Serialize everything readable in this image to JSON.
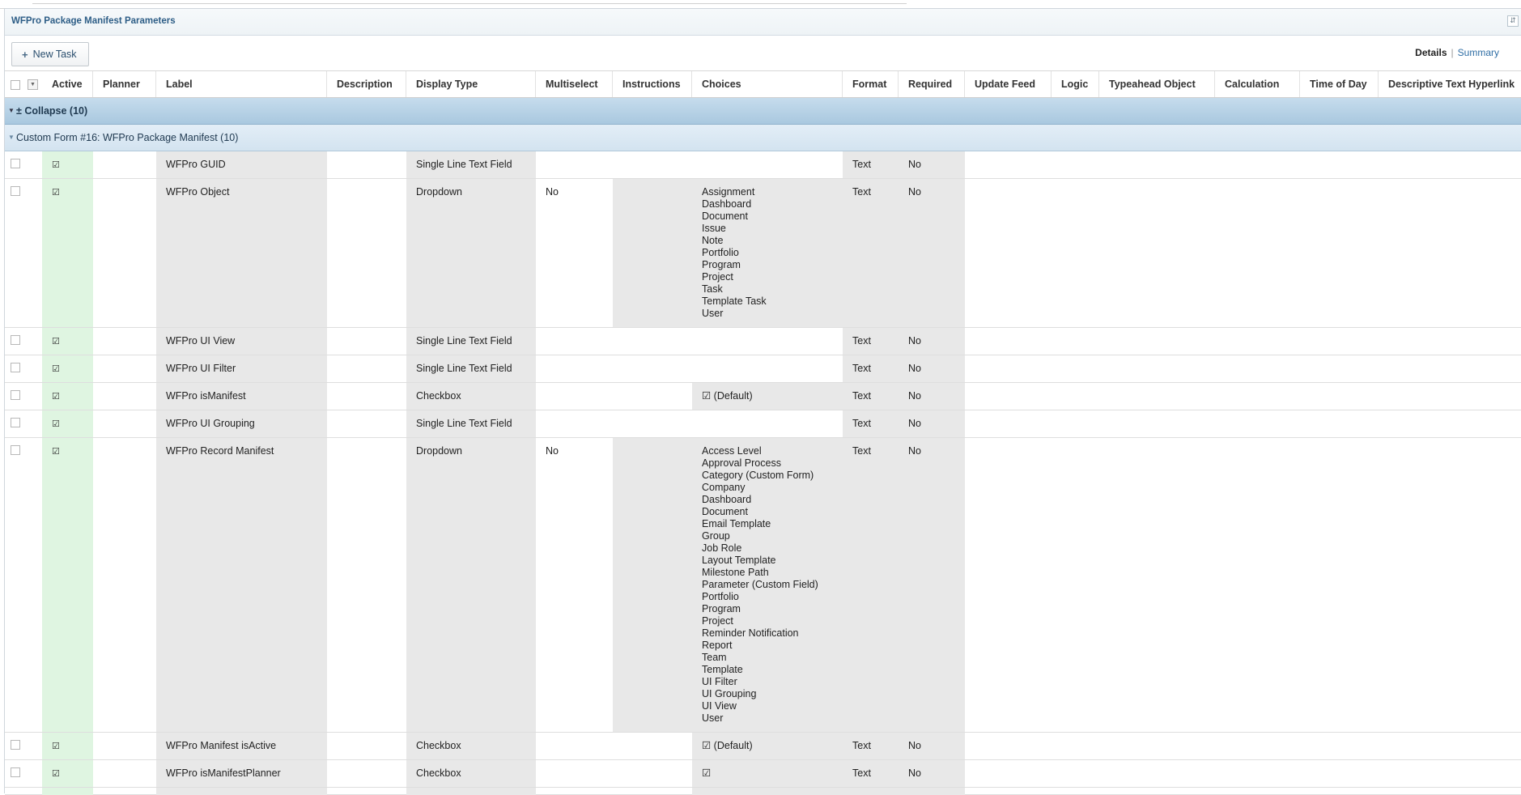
{
  "window": {
    "title": "WFPro Package Manifest Parameters"
  },
  "toolbar": {
    "new_task_label": "New Task",
    "details_label": "Details",
    "summary_label": "Summary"
  },
  "columns": [
    "Active",
    "Planner",
    "Label",
    "Description",
    "Display Type",
    "Multiselect",
    "Instructions",
    "Choices",
    "Format",
    "Required",
    "Update Feed",
    "Logic",
    "Typeahead Object",
    "Calculation",
    "Time of Day",
    "Descriptive Text Hyperlink"
  ],
  "groups": {
    "collapse_label": "± Collapse (10)",
    "form_label": "Custom Form #16: WFPro Package Manifest (10)"
  },
  "rows": [
    {
      "active": "☑",
      "label": "WFPro GUID",
      "display_type": "Single Line Text Field",
      "multiselect": "",
      "choices": [],
      "format": "Text",
      "required": "No"
    },
    {
      "active": "☑",
      "label": "WFPro Object",
      "display_type": "Dropdown",
      "multiselect": "No",
      "choices": [
        "Assignment",
        "Dashboard",
        "Document",
        "Issue",
        "Note",
        "Portfolio",
        "Program",
        "Project",
        "Task",
        "Template Task",
        "User"
      ],
      "format": "Text",
      "required": "No"
    },
    {
      "active": "☑",
      "label": "WFPro UI View",
      "display_type": "Single Line Text Field",
      "multiselect": "",
      "choices": [],
      "format": "Text",
      "required": "No"
    },
    {
      "active": "☑",
      "label": "WFPro UI Filter",
      "display_type": "Single Line Text Field",
      "multiselect": "",
      "choices": [],
      "format": "Text",
      "required": "No"
    },
    {
      "active": "☑",
      "label": "WFPro isManifest",
      "display_type": "Checkbox",
      "multiselect": "",
      "choices": [
        "☑ (Default)"
      ],
      "format": "Text",
      "required": "No"
    },
    {
      "active": "☑",
      "label": "WFPro UI Grouping",
      "display_type": "Single Line Text Field",
      "multiselect": "",
      "choices": [],
      "format": "Text",
      "required": "No"
    },
    {
      "active": "☑",
      "label": "WFPro Record Manifest",
      "display_type": "Dropdown",
      "multiselect": "No",
      "choices": [
        "Access Level",
        "Approval Process",
        "Category (Custom Form)",
        "Company",
        "Dashboard",
        "Document",
        "Email Template",
        "Group",
        "Job Role",
        "Layout Template",
        "Milestone Path",
        "Parameter (Custom Field)",
        "Portfolio",
        "Program",
        "Project",
        "Reminder Notification",
        "Report",
        "Team",
        "Template",
        "UI Filter",
        "UI Grouping",
        "UI View",
        "User"
      ],
      "format": "Text",
      "required": "No"
    },
    {
      "active": "☑",
      "label": "WFPro Manifest isActive",
      "display_type": "Checkbox",
      "multiselect": "",
      "choices": [
        "☑ (Default)"
      ],
      "format": "Text",
      "required": "No"
    },
    {
      "active": "☑",
      "label": "WFPro isManifestPlanner",
      "display_type": "Checkbox",
      "multiselect": "",
      "choices": [
        "☑"
      ],
      "format": "Text",
      "required": "No"
    },
    {
      "active": "",
      "label": "",
      "display_type": "",
      "multiselect": "",
      "choices": [],
      "format": "",
      "required": ""
    }
  ],
  "colors": {
    "accent": "#2e6da4",
    "group_bg": "#b7d2e6",
    "active_col": "#dff5e1",
    "shade_col": "#e8e8e8"
  }
}
